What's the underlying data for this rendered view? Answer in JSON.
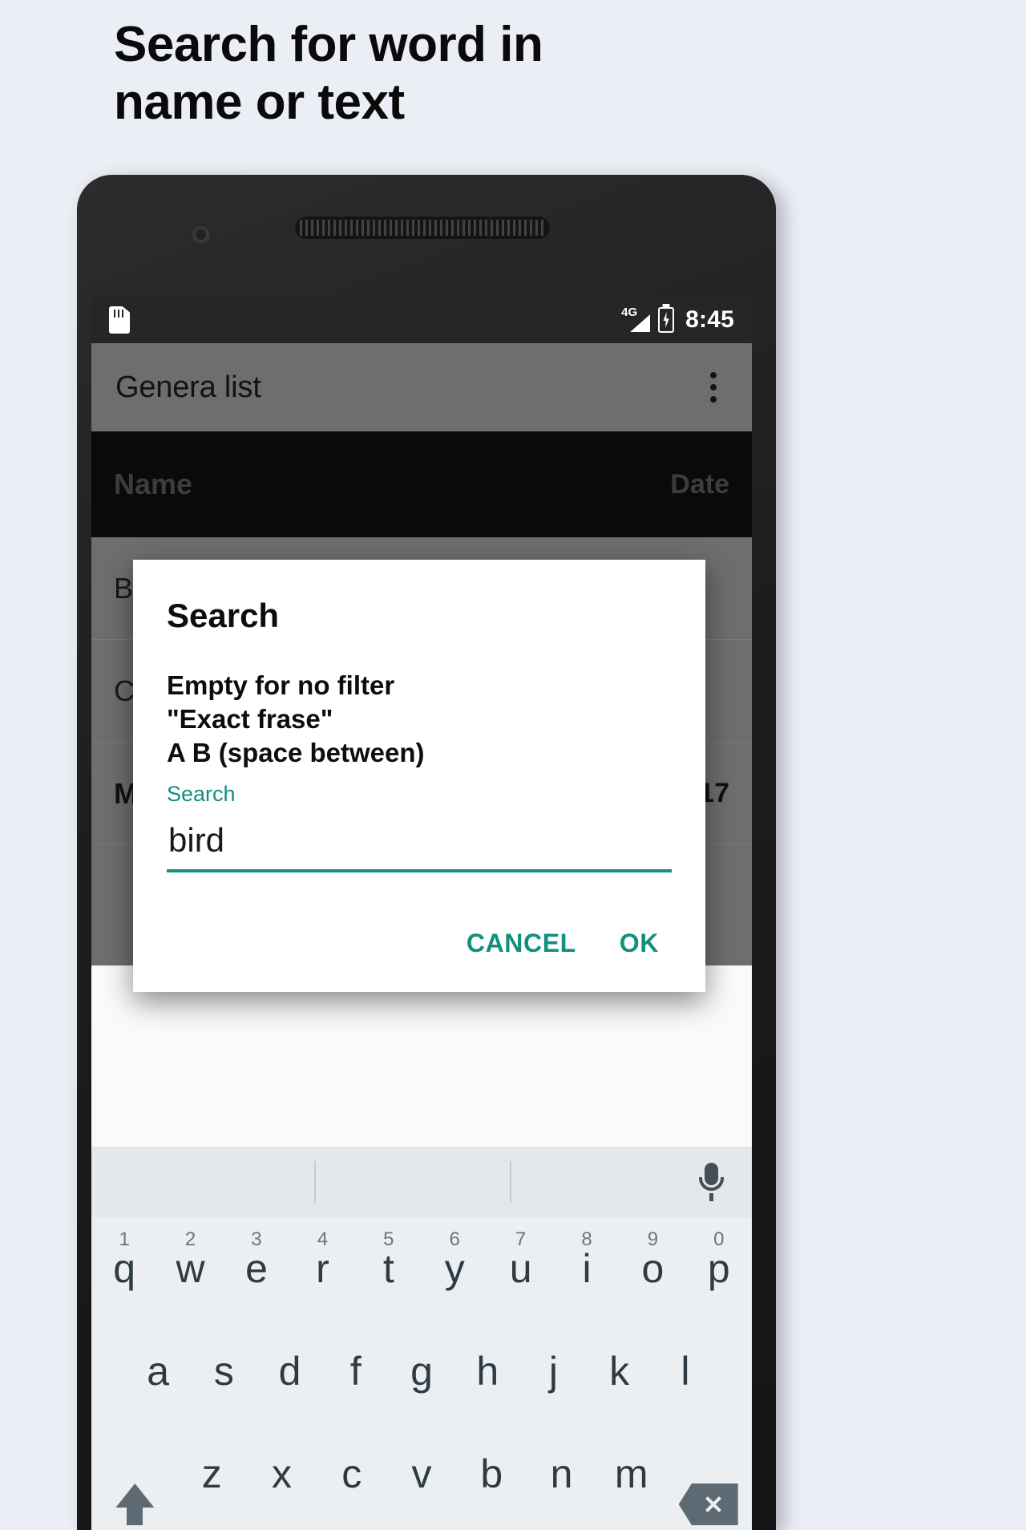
{
  "promo": {
    "heading_line1": "Search for word in",
    "heading_line2": "name or text"
  },
  "colors": {
    "accent_teal": "#13907e",
    "page_background": "#eceef5",
    "app_bar": "#6e6e6e",
    "status_bar": "#262626",
    "keyboard": "#eceff1"
  },
  "phone": {
    "status_bar": {
      "sd_icon": "sd-card-icon",
      "network": "4G",
      "signal_icon": "signal-bars-icon",
      "battery_icon": "battery-charging-icon",
      "time": "8:45"
    },
    "app_bar": {
      "title": "Genera list",
      "overflow_icon": "overflow-menu-icon"
    },
    "list": {
      "header": {
        "name": "Name",
        "date": "Date"
      },
      "rows": [
        {
          "name": "Business cards",
          "date": ""
        },
        {
          "name": "Cards",
          "date": ""
        },
        {
          "name": "Mail cards",
          "date": "Dec 16, 2017"
        }
      ]
    },
    "dialog": {
      "title": "Search",
      "message_line1": "Empty for no filter",
      "message_line2": "\"Exact frase\"",
      "message_line3": "A B (space between)",
      "field_label": "Search",
      "field_value": "bird",
      "field_placeholder": "Search",
      "cancel_label": "CANCEL",
      "ok_label": "OK"
    },
    "keyboard": {
      "mic_icon": "microphone-icon",
      "shift_icon": "shift-icon",
      "backspace_icon": "backspace-icon",
      "row1": [
        {
          "key": "q",
          "num": "1"
        },
        {
          "key": "w",
          "num": "2"
        },
        {
          "key": "e",
          "num": "3"
        },
        {
          "key": "r",
          "num": "4"
        },
        {
          "key": "t",
          "num": "5"
        },
        {
          "key": "y",
          "num": "6"
        },
        {
          "key": "u",
          "num": "7"
        },
        {
          "key": "i",
          "num": "8"
        },
        {
          "key": "o",
          "num": "9"
        },
        {
          "key": "p",
          "num": "0"
        }
      ],
      "row2": [
        {
          "key": "a"
        },
        {
          "key": "s"
        },
        {
          "key": "d"
        },
        {
          "key": "f"
        },
        {
          "key": "g"
        },
        {
          "key": "h"
        },
        {
          "key": "j"
        },
        {
          "key": "k"
        },
        {
          "key": "l"
        }
      ],
      "row3": [
        {
          "key": "z"
        },
        {
          "key": "x"
        },
        {
          "key": "c"
        },
        {
          "key": "v"
        },
        {
          "key": "b"
        },
        {
          "key": "n"
        },
        {
          "key": "m"
        }
      ]
    }
  }
}
